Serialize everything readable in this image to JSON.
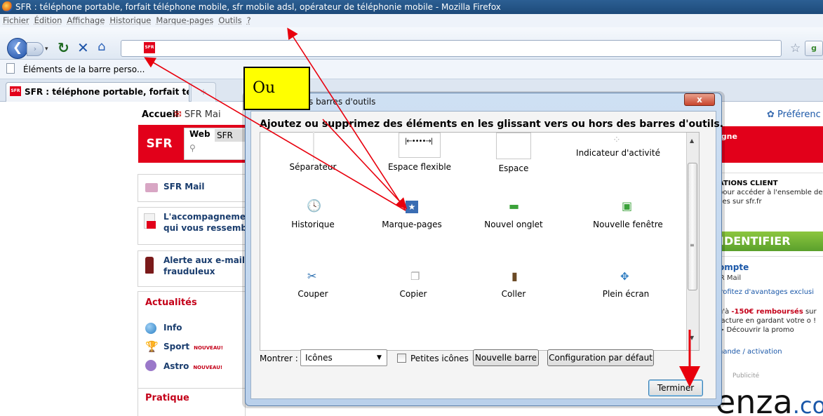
{
  "window": {
    "title": "SFR : téléphone portable, forfait téléphone mobile, sfr mobile adsl, opérateur de téléphonie mobile - Mozilla Firefox"
  },
  "menubar": {
    "items": [
      "Fichier",
      "Édition",
      "Affichage",
      "Historique",
      "Marque-pages",
      "Outils",
      "?"
    ]
  },
  "navbar": {
    "back": "❮",
    "forward": "›",
    "url": ""
  },
  "bookmarks": {
    "label": "Éléments de la barre perso..."
  },
  "tabs": [
    {
      "label": "SFR : téléphone portable, forfait télé..."
    }
  ],
  "page": {
    "accueil": "Accueil",
    "sfr_mail_top": "SFR Mai",
    "logo": "SFR",
    "search_tabs": [
      "Web",
      "SFR"
    ],
    "side": {
      "mail": "SFR Mail",
      "accompagnement_1": "L'accompagnement",
      "accompagnement_2": "qui vous ressemble",
      "alerte_1": "Alerte aux e-mails",
      "alerte_2": "frauduleux",
      "actualites": "Actualités",
      "info": "Info",
      "sport": "Sport",
      "astro": "Astro",
      "nouveau": "NOUVEAU!",
      "pratique": "Pratique"
    },
    "right": {
      "preferences": "Préférenc",
      "red_text": "igne",
      "client_title": "ATIONS CLIENT",
      "client_desc": "pour accéder à l'ensemble de ces sur sfr.fr",
      "identify": "IDENTIFIER",
      "compte": "ompte",
      "sfr_mail": "FR Mail",
      "avantages": "profitez d'avantages exclusi",
      "promo_1": "u'à ",
      "promo_amount": "-150€ remboursés",
      "promo_2": " sur facture en gardant votre o ! > Découvrir la promo",
      "commande": "nande / activation",
      "pub": "Publicité",
      "logo": "enza",
      "logo_tail": ".co"
    }
  },
  "dialog": {
    "title": "s barres d'outils",
    "close": "x",
    "heading": "Ajoutez ou supprimez des éléments en les glissant vers ou hors des barres d'outils.",
    "items": [
      {
        "label": "Séparateur",
        "icon": "separator-icon"
      },
      {
        "label": "Espace flexible",
        "icon": "flexible-space-icon"
      },
      {
        "label": "Espace",
        "icon": "space-icon"
      },
      {
        "label": "Indicateur d'activité",
        "icon": "throbber-icon"
      },
      {
        "label": "Historique",
        "icon": "history-icon"
      },
      {
        "label": "Marque-pages",
        "icon": "bookmarks-icon"
      },
      {
        "label": "Nouvel onglet",
        "icon": "new-tab-icon"
      },
      {
        "label": "Nouvelle fenêtre",
        "icon": "new-window-icon"
      },
      {
        "label": "Couper",
        "icon": "cut-icon"
      },
      {
        "label": "Copier",
        "icon": "copy-icon"
      },
      {
        "label": "Coller",
        "icon": "paste-icon"
      },
      {
        "label": "Plein écran",
        "icon": "fullscreen-icon"
      }
    ],
    "show_label": "Montrer :",
    "show_value": "Icônes",
    "small_icons": "Petites icônes",
    "new_bar": "Nouvelle barre",
    "default": "Configuration par défaut",
    "done": "Terminer"
  },
  "annotation": {
    "text": "Ou",
    "arrow_color": "#e8000d"
  },
  "colors": {
    "sfr_red": "#e2001a",
    "link_blue": "#1a57a8",
    "accent_green": "#6ab536"
  }
}
